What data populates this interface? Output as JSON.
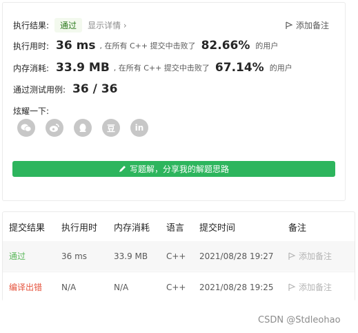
{
  "summary": {
    "result_label": "执行结果:",
    "result_status": "通过",
    "show_details": "显示详情 ›",
    "add_note": "添加备注",
    "runtime_label": "执行用时:",
    "runtime_value": "36 ms",
    "runtime_text": ", 在所有 C++ 提交中击败了",
    "runtime_percent": "82.66%",
    "runtime_suffix": "的用户",
    "memory_label": "内存消耗:",
    "memory_value": "33.9 MB",
    "memory_text": ", 在所有 C++ 提交中击败了",
    "memory_percent": "67.14%",
    "memory_suffix": "的用户",
    "tests_label": "通过测试用例:",
    "tests_value": "36 / 36",
    "share_label": "炫耀一下:",
    "share_icons": [
      "wechat-icon",
      "weibo-icon",
      "qq-icon",
      "douban-icon",
      "linkedin-icon"
    ],
    "share_glyphs": {
      "douban": "豆",
      "linkedin": "in"
    },
    "solution_button": "写题解，分享我的解题思路"
  },
  "table": {
    "headers": [
      "提交结果",
      "执行用时",
      "内存消耗",
      "语言",
      "提交时间",
      "备注"
    ],
    "rows": [
      {
        "result": "通过",
        "runtime": "36 ms",
        "memory": "33.9 MB",
        "language": "C++",
        "time": "2021/08/28 19:27",
        "note": "添加备注"
      },
      {
        "result": "编译出错",
        "runtime": "N/A",
        "memory": "N/A",
        "language": "C++",
        "time": "2021/08/28 19:25",
        "note": "添加备注"
      }
    ]
  },
  "watermark": "CSDN @Stdleohao",
  "colors": {
    "accent_green": "#2db55d",
    "pass_green": "#5cb85c",
    "error_red": "#e5533d"
  }
}
